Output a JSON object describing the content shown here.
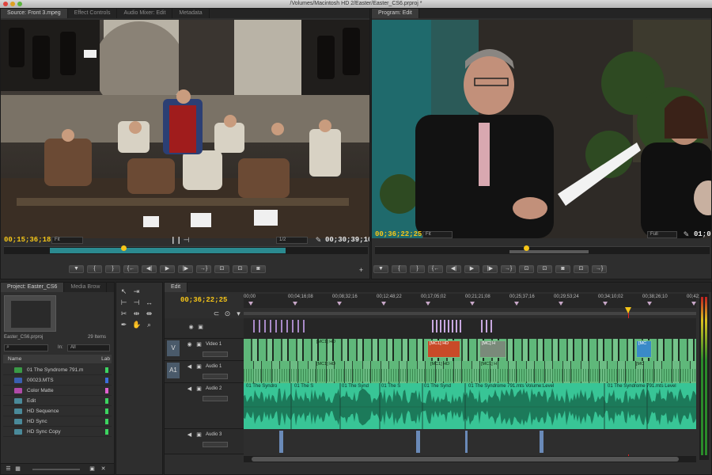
{
  "window": {
    "title": "/Volumes/Macintosh HD 2/Easter/Easter_CS6.prproj *"
  },
  "source_monitor": {
    "tabs": [
      "Source: Front 3.mpeg",
      "Effect Controls",
      "Audio Mixer: Edit",
      "Metadata"
    ],
    "timecode_in": "00;15;36;18",
    "fit": "Fit",
    "resolution": "1/2",
    "timecode_duration": "00;30;39;10"
  },
  "program_monitor": {
    "tabs": [
      "Program: Edit"
    ],
    "timecode": "00;36;22;25",
    "fit": "Fit",
    "resolution": "Full",
    "timecode_duration": "01;00"
  },
  "transport": {
    "marker": "▼",
    "in": "{",
    "out": "}",
    "go_in": "{←",
    "step_back": "◀|",
    "play": "▶",
    "step_fwd": "|▶",
    "go_out": "→}",
    "insert": "⊡",
    "overwrite": "⊡",
    "export": "◙",
    "add": "+"
  },
  "project": {
    "tabs": [
      "Project: Easter_CS6",
      "Media Brow"
    ],
    "file": "Easter_CS6.prproj",
    "count": "29 Items",
    "in_label": "In:",
    "in_value": "All",
    "col_name": "Name",
    "col_label": "Lab",
    "items": [
      {
        "name": "01 The Syndrome 791.m",
        "color": "#3cd460",
        "icon": "#3a9a46"
      },
      {
        "name": "00023.MTS",
        "color": "#3c6edc",
        "icon": "#3a5fb0"
      },
      {
        "name": "Color Matte",
        "color": "#e060d0",
        "icon": "#b04aa8"
      },
      {
        "name": "Edit",
        "color": "#3cd460",
        "icon": "#4a8a9a"
      },
      {
        "name": "HD Sequence",
        "color": "#3cd460",
        "icon": "#4a8a9a"
      },
      {
        "name": "HD Sync",
        "color": "#3cd460",
        "icon": "#4a8a9a"
      },
      {
        "name": "HD Sync Copy",
        "color": "#3cd460",
        "icon": "#4a8a9a"
      }
    ]
  },
  "timeline": {
    "tab": "Edit",
    "timecode": "00;36;22;25",
    "ticks": [
      "00;00",
      "00;04;16;08",
      "00;08;32;16",
      "00;12;48;22",
      "00;17;05;02",
      "00;21;21;08",
      "00;25;37;16",
      "00;29;53;24",
      "00;34;10;02",
      "00;38;26;10",
      "00;42;"
    ],
    "tracks": {
      "video1": "Video 1",
      "audio1": "Audio 1",
      "audio2": "Audio 2",
      "audio3": "Audio 3",
      "v": "V",
      "a1": "A1"
    },
    "clip_labels": {
      "mc_a": "[MC1] HD",
      "mc_b": "[MC1] HD",
      "mc_c": "[MC] H",
      "mc_d": "[MC",
      "mc_e": "[MC1] HD",
      "mc_f": "[MC1] HD",
      "mc_g": "[MC1] H",
      "mc_h": "[MC",
      "aud_1": "01 The Syndro",
      "aud_2": "01 The S",
      "aud_3": "01 The Synd",
      "aud_4": "01 The S",
      "aud_5": "01 The Synd",
      "aud_6": "01 The Syndrome 791.mts Volume:Level",
      "aud_7": "01 The Syndrome 791.mts Level"
    }
  },
  "colors": {
    "accent": "#f5c518",
    "video_clip": "#5fb87a",
    "audio_clip": "#3fc49a",
    "playhead": "#e02020"
  }
}
